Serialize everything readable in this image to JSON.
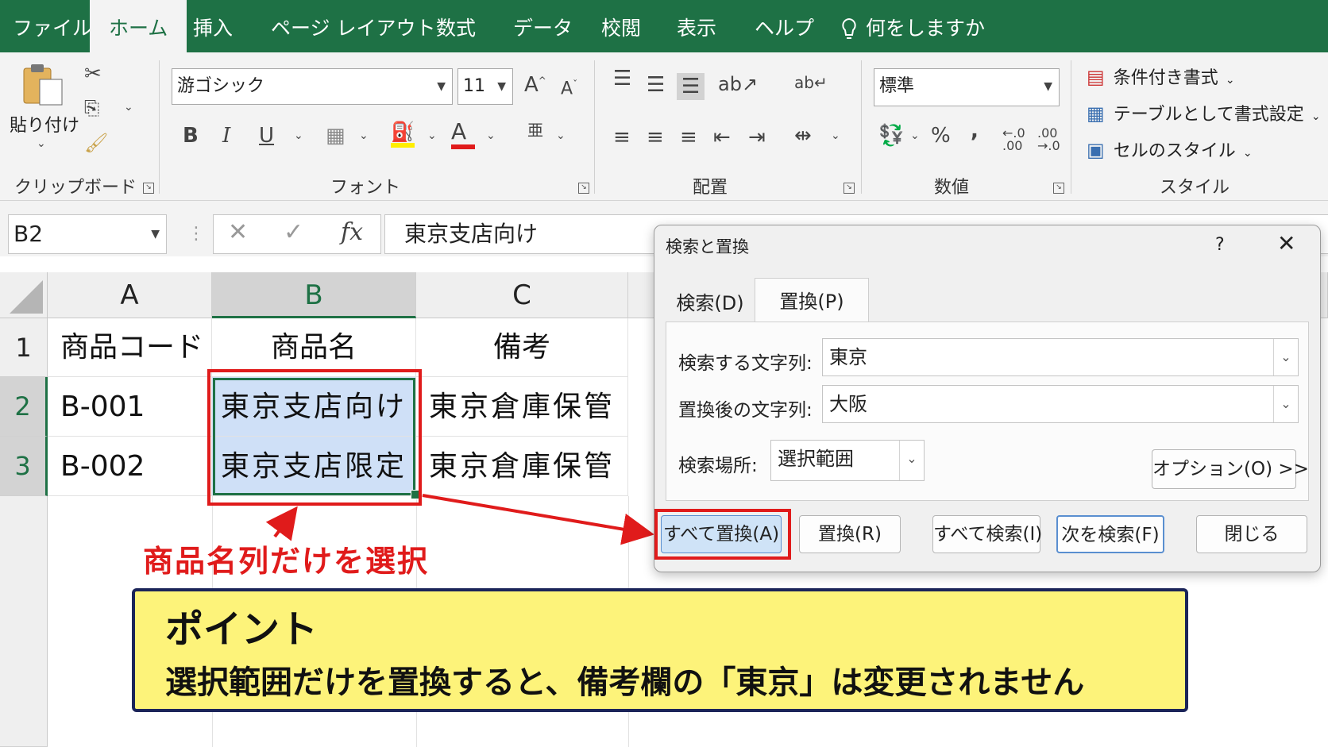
{
  "ribbon_tabs": [
    "ファイル",
    "ホーム",
    "挿入",
    "ページ レイアウト",
    "数式",
    "データ",
    "校閲",
    "表示",
    "ヘルプ"
  ],
  "tell_me": "何をしますか",
  "clipboard": {
    "paste_label": "貼り付け",
    "group_label": "クリップボード"
  },
  "font": {
    "name": "游ゴシック",
    "size": "11",
    "group_label": "フォント",
    "bold": "B",
    "italic": "I",
    "underline": "U"
  },
  "alignment": {
    "group_label": "配置"
  },
  "number": {
    "format": "標準",
    "group_label": "数値",
    "percent": "%",
    "comma": ","
  },
  "styles": {
    "conditional": "条件付き書式",
    "as_table": "テーブルとして書式設定",
    "cell_styles": "セルのスタイル",
    "group_label": "スタイル"
  },
  "formula_bar": {
    "name_box": "B2",
    "fx": "fx",
    "content": "東京支店向け"
  },
  "sheet": {
    "columns": [
      "A",
      "B",
      "C"
    ],
    "rows": [
      {
        "num": "1",
        "cells": [
          "商品コード",
          "商品名",
          "備考"
        ]
      },
      {
        "num": "2",
        "cells": [
          "B-001",
          "東京支店向け",
          "東京倉庫保管"
        ]
      },
      {
        "num": "3",
        "cells": [
          "B-002",
          "東京支店限定",
          "東京倉庫保管"
        ]
      }
    ]
  },
  "dialog": {
    "title": "検索と置換",
    "help": "?",
    "tabs": [
      "検索(D)",
      "置換(P)"
    ],
    "find_label": "検索する文字列:",
    "find_value": "東京",
    "replace_label": "置換後の文字列:",
    "replace_value": "大阪",
    "within_label": "検索場所:",
    "within_value": "選択範囲",
    "options_button": "オプション(O) >>",
    "buttons": [
      "すべて置換(A)",
      "置換(R)",
      "すべて検索(I)",
      "次を検索(F)",
      "閉じる"
    ]
  },
  "annotation": {
    "text": "商品名列だけを選択"
  },
  "callout": {
    "title": "ポイント",
    "body": "選択範囲だけを置換すると、備考欄の「東京」は変更されません"
  },
  "colors": {
    "excel_green": "#1e7145",
    "highlight_red": "#e01b1b",
    "callout_bg": "#fdf37a",
    "selection_blue": "#cfe0f7"
  }
}
